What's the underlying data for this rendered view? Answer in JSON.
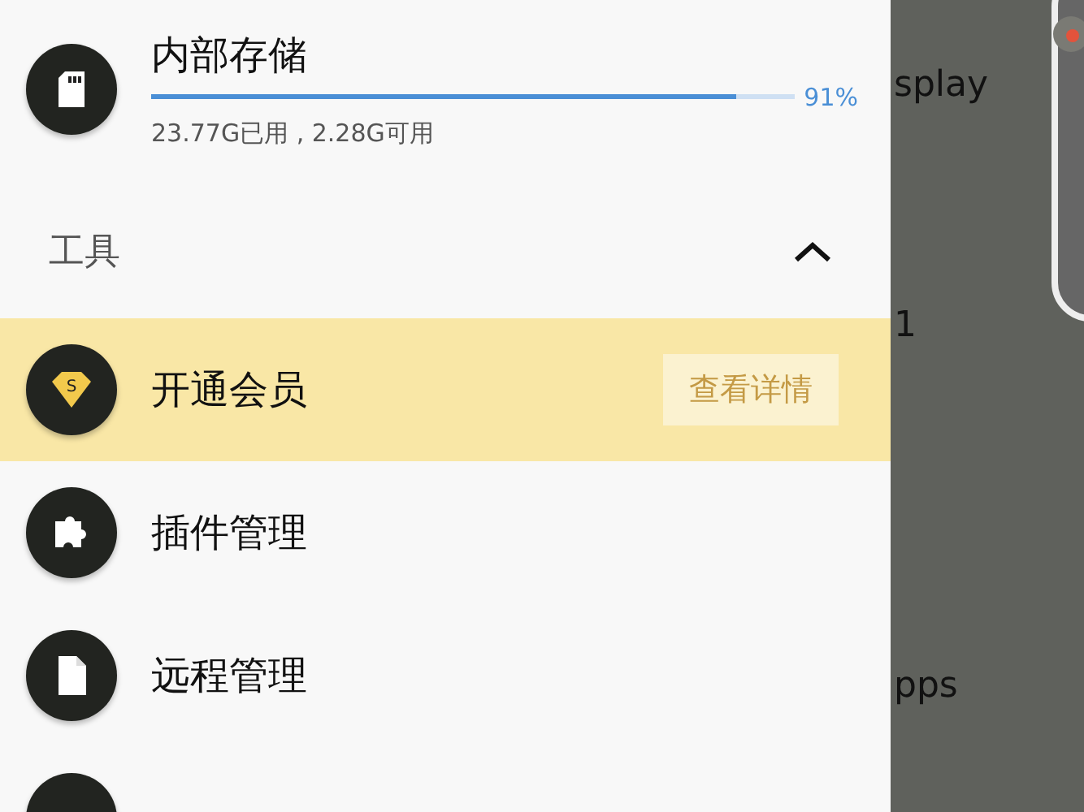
{
  "storage": {
    "title": "内部存储",
    "level": 0.91,
    "percent": "91%",
    "usage": "23.77G已用 , 2.28G可用"
  },
  "section": {
    "title": "工具",
    "expanded": true
  },
  "items": [
    {
      "kind": "member",
      "label": "开通会员",
      "badge_letter": "S",
      "action": "查看详情",
      "highlighted": true
    },
    {
      "kind": "plugin",
      "label": "插件管理",
      "highlighted": false
    },
    {
      "kind": "file",
      "label": "远程管理",
      "highlighted": false
    },
    {
      "kind": "partial",
      "highlighted": false
    }
  ],
  "background_texts": [
    "splay",
    "1",
    "pps"
  ]
}
